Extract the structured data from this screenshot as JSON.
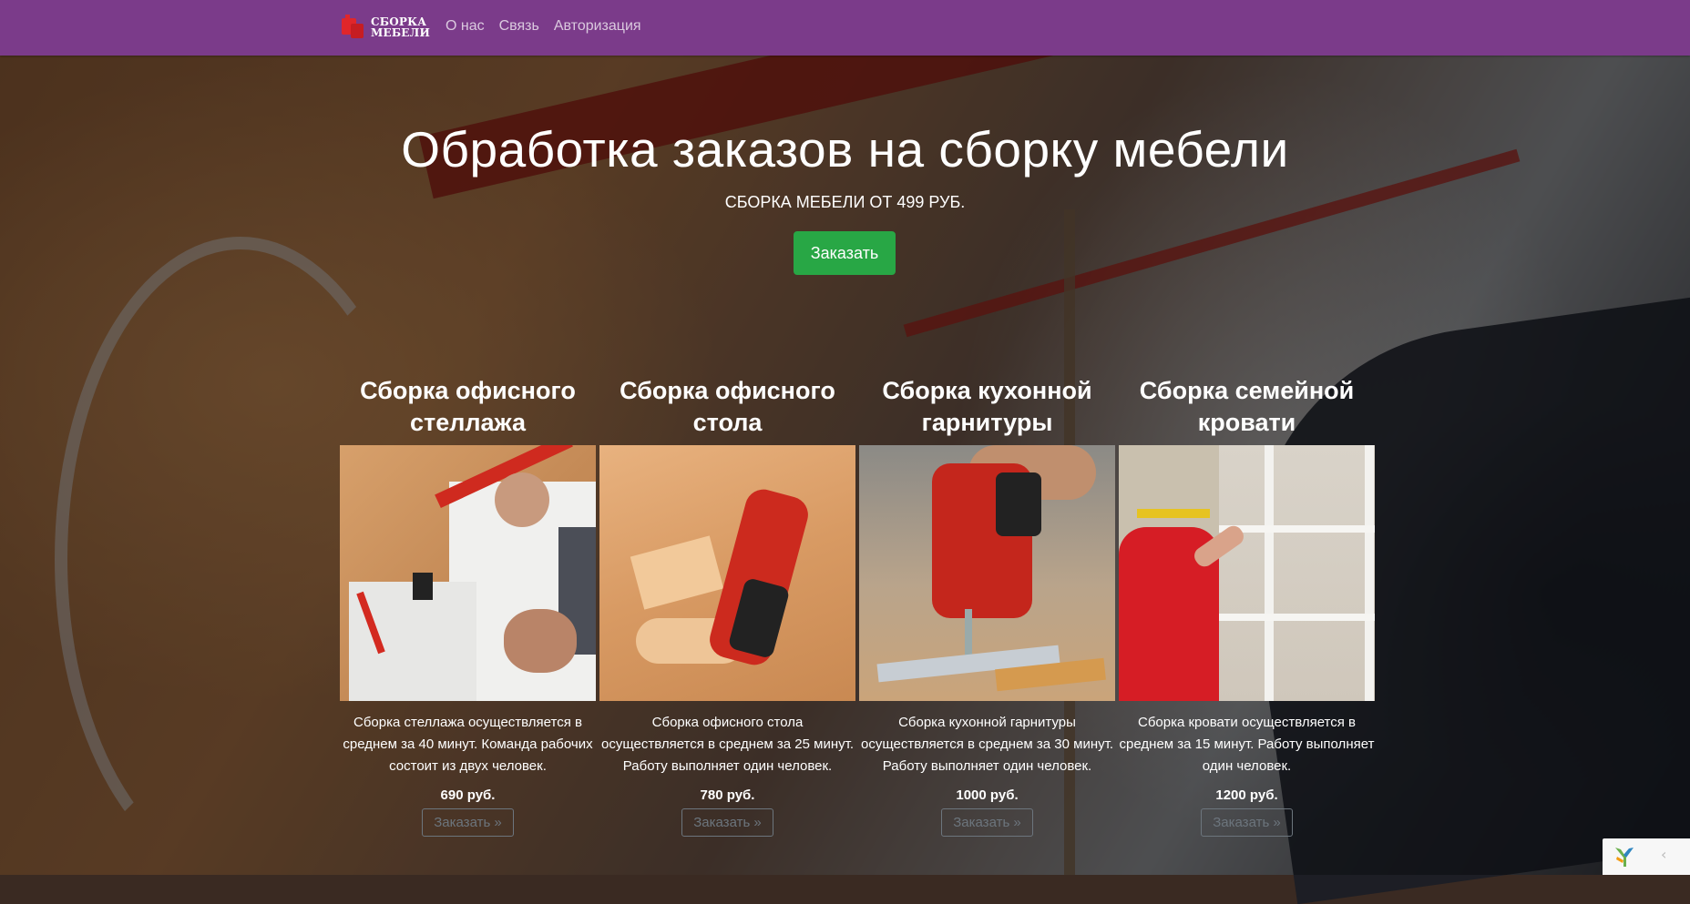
{
  "nav": {
    "brand_line1": "СБОРКА",
    "brand_line2": "МЕБЕЛИ",
    "links": [
      "О нас",
      "Связь",
      "Авторизация"
    ],
    "bg_color": "#7b3b8a"
  },
  "hero": {
    "title": "Обработка заказов на сборку мебели",
    "subtitle": "СБОРКА МЕБЕЛИ ОТ 499 РУБ.",
    "button": "Заказать",
    "button_color": "#28a745"
  },
  "cards": [
    {
      "title": "Сборка офисного стеллажа",
      "description": "Сборка стеллажа осуществляется в среднем за 40 минут. Команда рабочих состоит из двух человек.",
      "price": "690 руб.",
      "button": "Заказать »"
    },
    {
      "title": "Сборка офисного стола",
      "description": "Сборка офисного стола осуществляется в среднем за 25 минут. Работу выполняет один человек.",
      "price": "780 руб.",
      "button": "Заказать »"
    },
    {
      "title": "Сборка кухонной гарнитуры",
      "description": "Сборка кухонной гарнитуры осуществляется в среднем за 30 минут. Работу выполняет один человек.",
      "price": "1000 руб.",
      "button": "Заказать »"
    },
    {
      "title": "Сборка семейной кровати",
      "description": "Сборка кровати осуществляется в среднем за 15 минут. Работу выполняет один человек.",
      "price": "1200 руб.",
      "button": "Заказать »"
    }
  ],
  "debug_toolbar": {
    "logo": "yii-logo-icon",
    "toggle": "‹"
  }
}
